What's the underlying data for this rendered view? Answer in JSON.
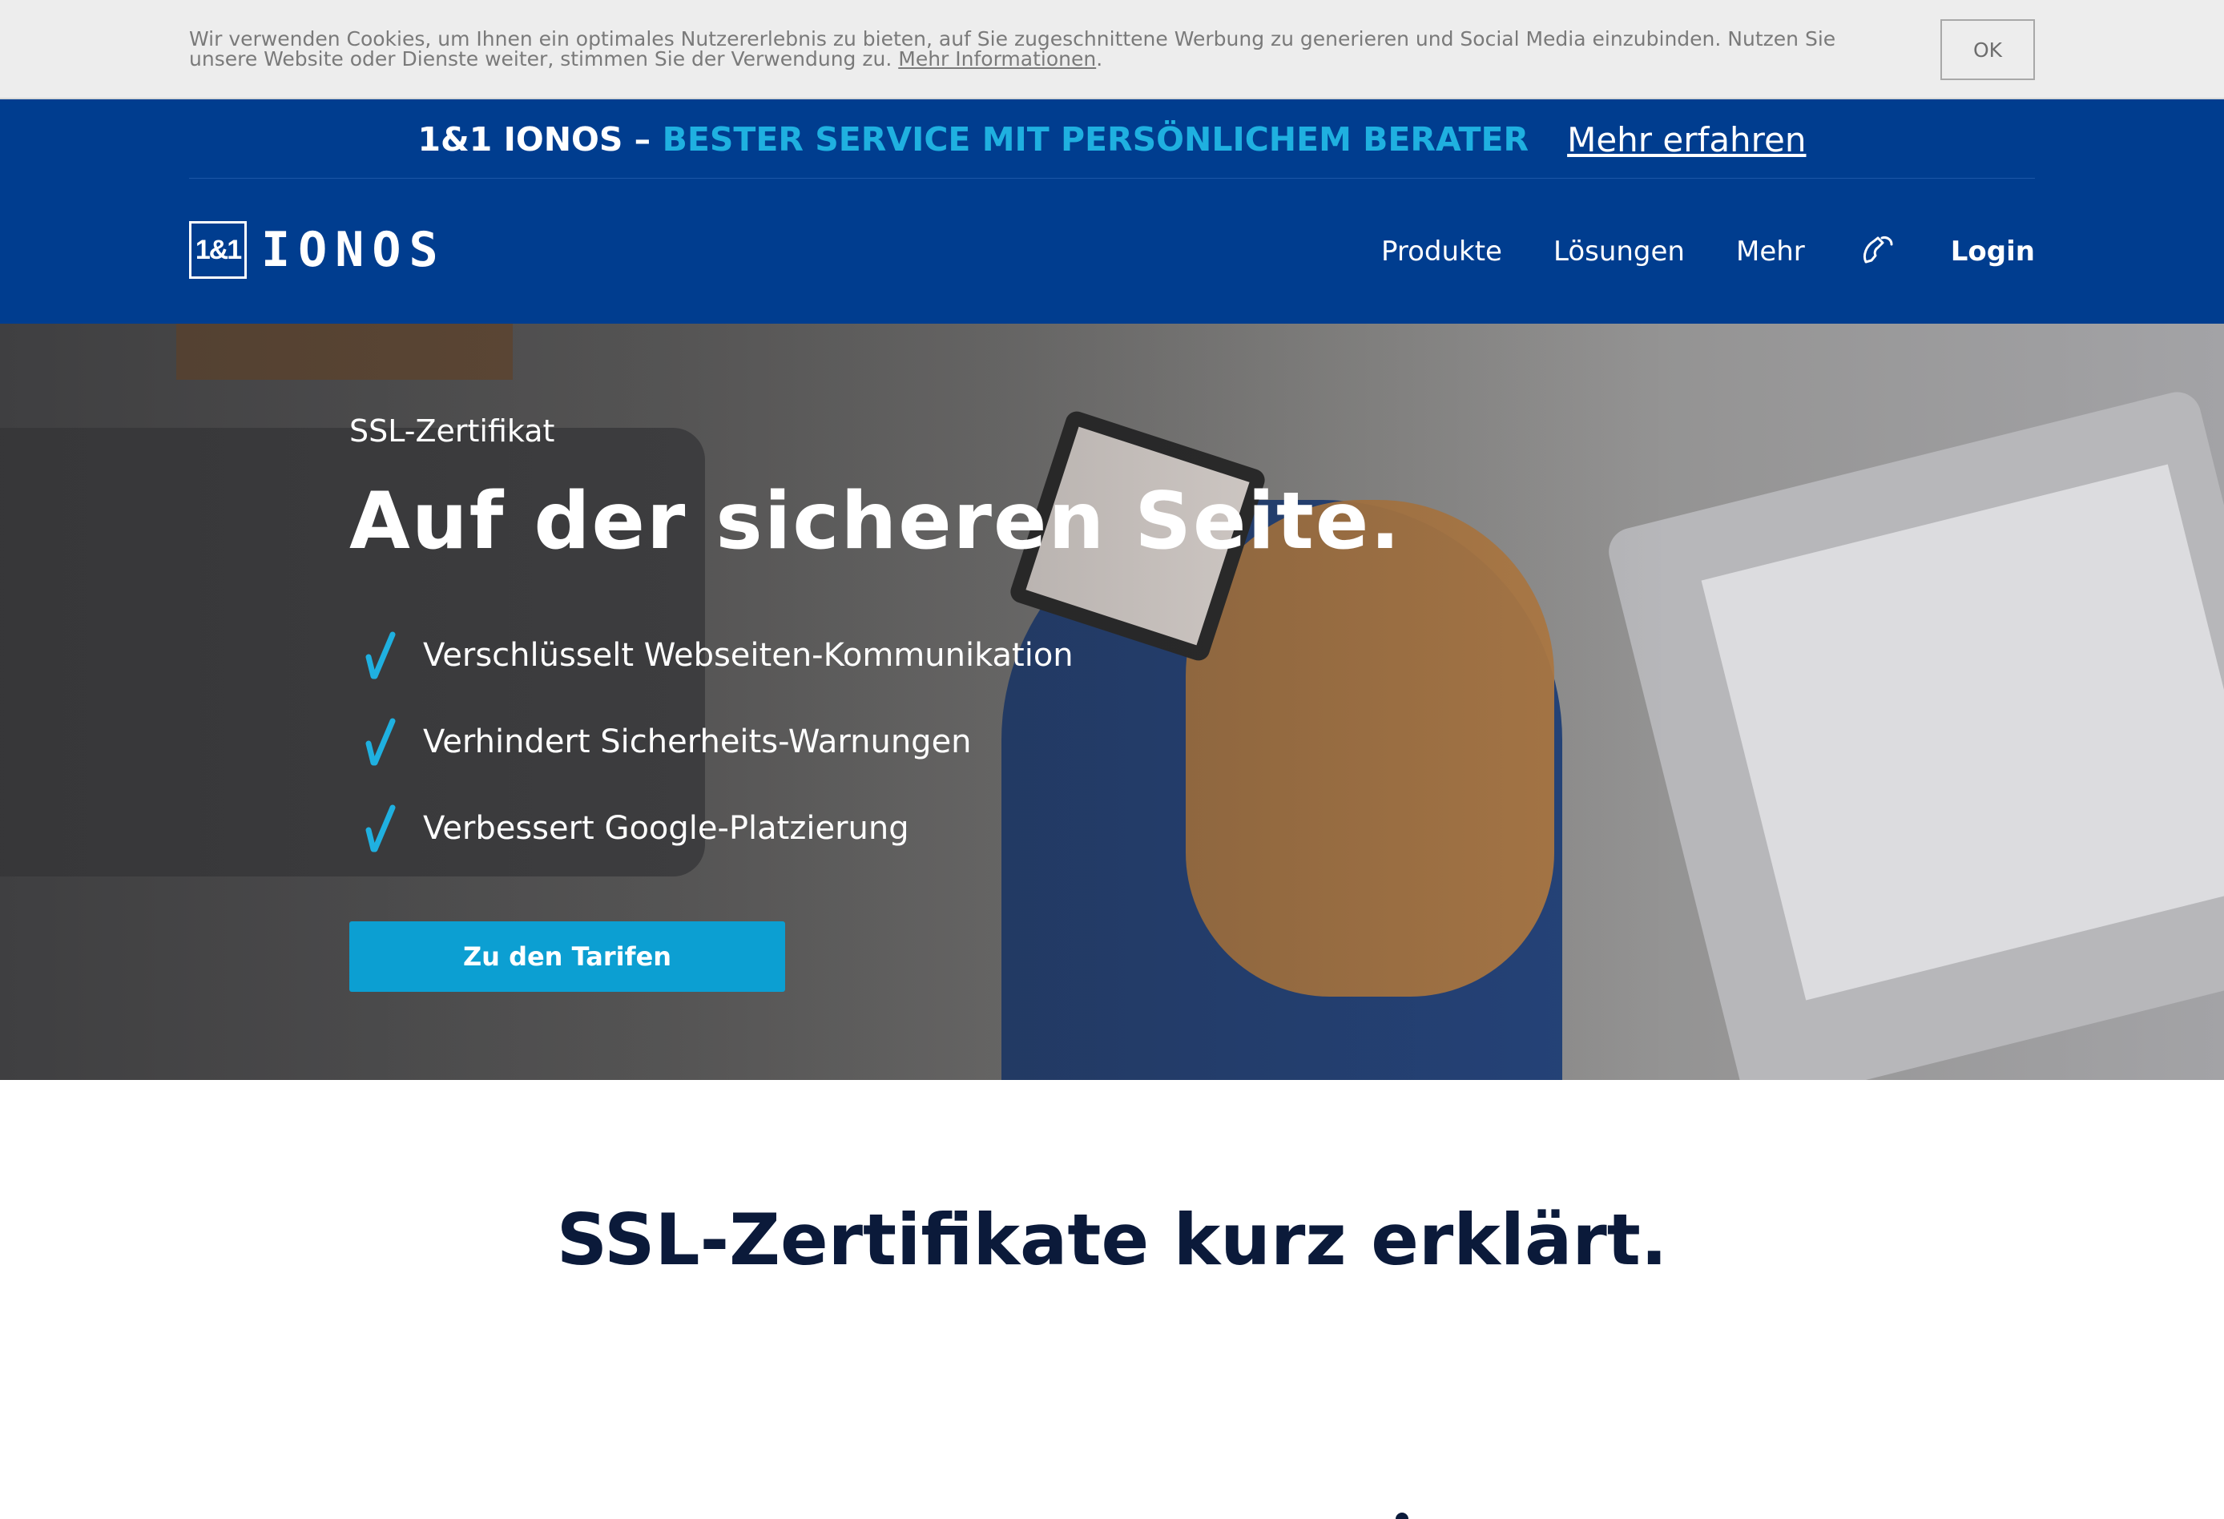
{
  "cookie": {
    "text": "Wir verwenden Cookies, um Ihnen ein optimales Nutzererlebnis zu bieten, auf Sie zugeschnittene Werbung zu generieren und Social Media einzubinden. Nutzen Sie unsere Website oder Dienste weiter, stimmen Sie der Verwendung zu.",
    "link_label": "Mehr Informationen",
    "ok_label": "OK"
  },
  "promo": {
    "brand": "1&1 IONOS –",
    "claim": "BESTER SERVICE MIT PERSÖNLICHEM BERATER",
    "link": "Mehr erfahren"
  },
  "header": {
    "logo_box": "1&1",
    "logo_word": "IONOS",
    "nav": [
      "Produkte",
      "Lösungen",
      "Mehr"
    ],
    "login": "Login",
    "icons": {
      "phone": "phone-icon"
    }
  },
  "hero": {
    "kicker": "SSL-Zertifikat",
    "title": "Auf der sicheren Seite.",
    "features": [
      "Verschlüsselt Webseiten-Kommunikation",
      "Verhindert Sicherheits-Warnungen",
      "Verbessert Google-Platzierung"
    ],
    "cta": "Zu den Tarifen",
    "icons": {
      "check": "check-icon"
    }
  },
  "section": {
    "title": "SSL-Zertifikate kurz erklärt."
  },
  "colors": {
    "brand_blue": "#003d8f",
    "accent_cyan": "#1fb0e0",
    "cta_blue": "#0c9fd2",
    "heading_navy": "#0b1a3a"
  }
}
